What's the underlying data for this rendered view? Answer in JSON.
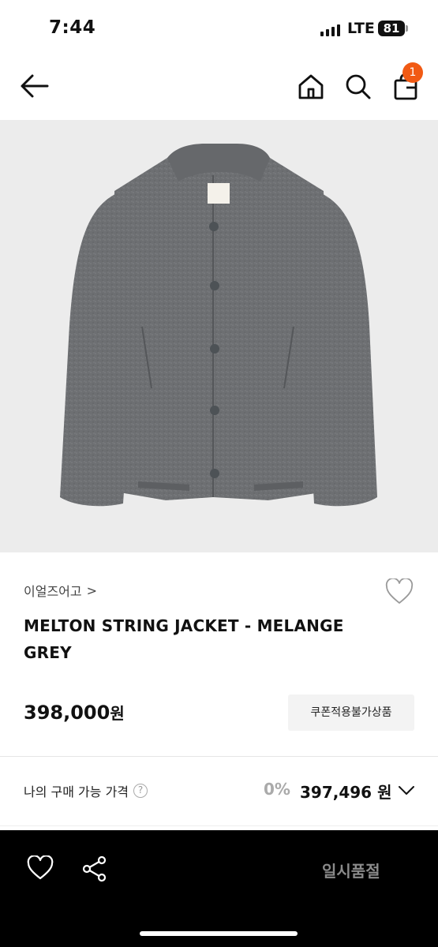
{
  "status_bar": {
    "time": "7:44",
    "network": "LTE",
    "battery": "81"
  },
  "header": {
    "back_icon": "arrow-left-icon",
    "home_icon": "home-icon",
    "search_icon": "search-icon",
    "cart_icon": "shopping-bag-icon",
    "cart_count": "1",
    "badge_color": "#f15a14"
  },
  "product": {
    "image": "grey-melton-jacket",
    "brand": "이얼즈어고",
    "brand_chevron": ">",
    "title": "MELTON STRING JACKET - MELANGE GREY",
    "price": "398,000",
    "price_unit": "원",
    "coupon_label": "쿠폰적용불가상품"
  },
  "purchase": {
    "label": "나의 구매 가능 가격",
    "help": "?",
    "discount": "0%",
    "final_price": "397,496",
    "final_unit": "원"
  },
  "bottom_bar": {
    "wish_icon": "heart-outline-icon",
    "share_icon": "share-icon",
    "action_label": "일시품절"
  }
}
